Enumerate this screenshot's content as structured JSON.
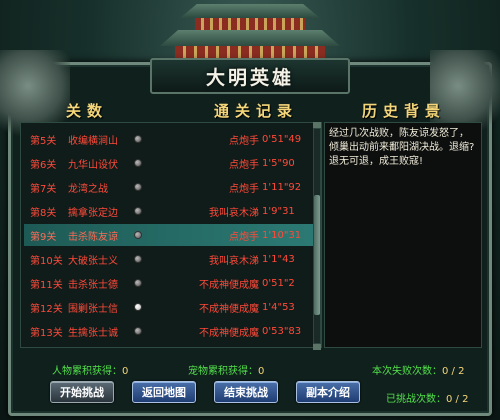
{
  "title": "大明英雄",
  "headers": {
    "levels": "关数",
    "record": "通关记录",
    "history": "历史背景"
  },
  "rows": [
    {
      "level": "第5关",
      "stage": "收编横涧山",
      "hero": "点炮手",
      "time": "0'51\"49",
      "checked": false
    },
    {
      "level": "第6关",
      "stage": "九华山设伏",
      "hero": "点炮手",
      "time": "1'5\"90",
      "checked": false
    },
    {
      "level": "第7关",
      "stage": "龙湾之战",
      "hero": "点炮手",
      "time": "1'11\"92",
      "checked": false
    },
    {
      "level": "第8关",
      "stage": "擒拿张定边",
      "hero": "我叫哀木涕",
      "time": "1'9\"31",
      "checked": false
    },
    {
      "level": "第9关",
      "stage": "击杀陈友谅",
      "hero": "点炮手",
      "time": "1'10\"31",
      "checked": false,
      "selected": true
    },
    {
      "level": "第10关",
      "stage": "大破张士义",
      "hero": "我叫哀木涕",
      "time": "1'1\"43",
      "checked": false
    },
    {
      "level": "第11关",
      "stage": "击杀张士德",
      "hero": "不成神便成魔",
      "time": "0'51\"2",
      "checked": false
    },
    {
      "level": "第12关",
      "stage": "围剿张士信",
      "hero": "不成神便成魔",
      "time": "1'4\"53",
      "checked": true
    },
    {
      "level": "第13关",
      "stage": "生擒张士诚",
      "hero": "不成神便成魔",
      "time": "0'53\"83",
      "checked": false
    }
  ],
  "history_text": "经过几次战败，陈友谅发怒了，倾巢出动前来鄱阳湖决战。退缩?退无可退，成王败寇!",
  "stats": {
    "hero_label": "人物累积获得：",
    "hero_value": "0",
    "pet_label": "宠物累积获得：",
    "pet_value": "0",
    "fail_label": "本次失败次数：",
    "fail_value": "0 / 2",
    "challenged_label": "已挑战次数：",
    "challenged_value": "0 / 2"
  },
  "buttons": {
    "start": "开始挑战",
    "back": "返回地图",
    "end": "结束挑战",
    "intro": "副本介绍"
  },
  "colors": {
    "stage_red": "#ff4a3a",
    "stat_green": "#52e04a",
    "header_gold": "#f4d67a"
  }
}
